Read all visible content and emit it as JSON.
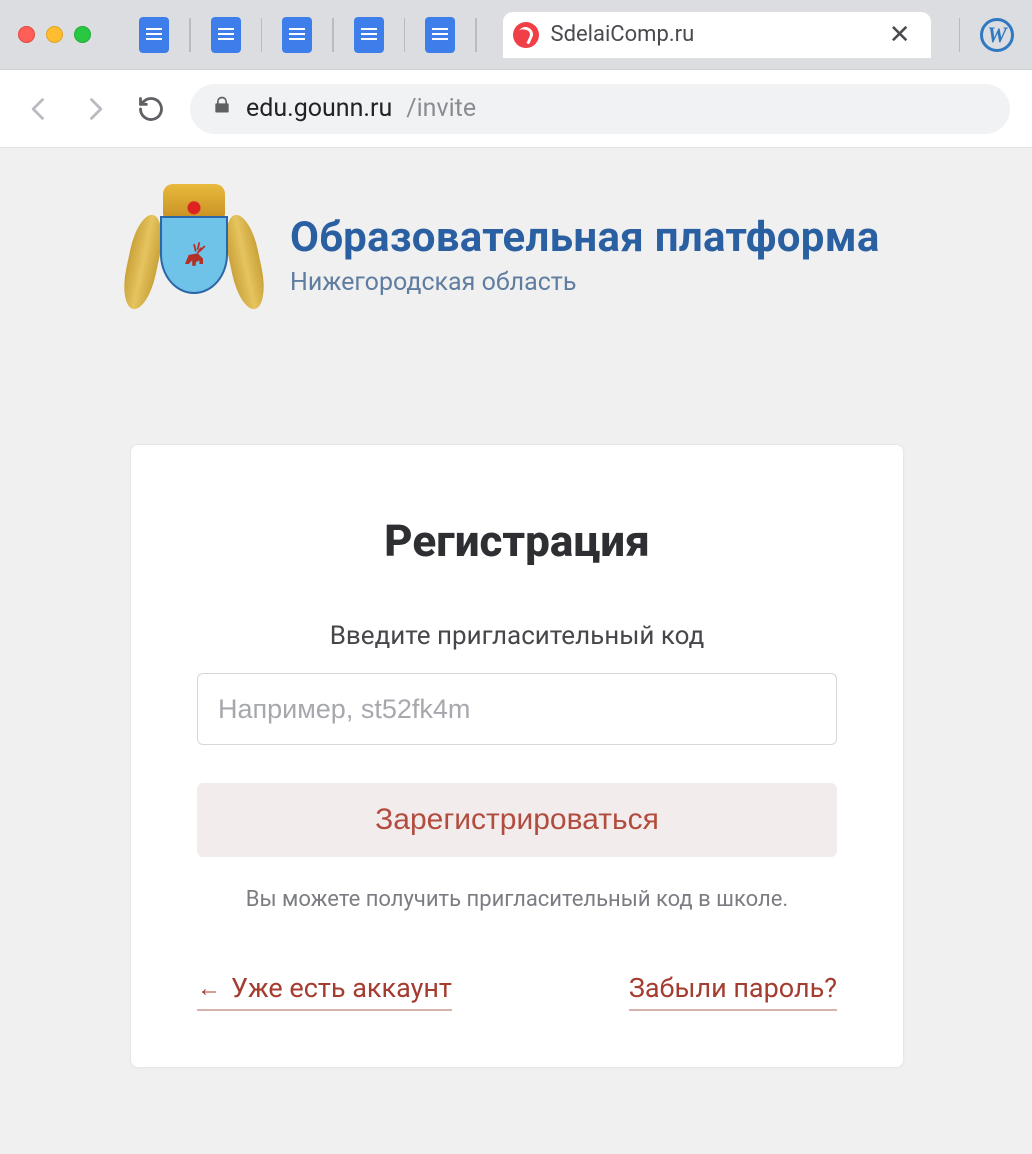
{
  "tabbar": {
    "site_tab_title": "SdelaiComp.ru"
  },
  "address": {
    "host": "edu.gounn.ru",
    "path": "/invite"
  },
  "brand": {
    "title": "Образовательная платформа",
    "subtitle": "Нижегородская область"
  },
  "card": {
    "title": "Регистрация",
    "label": "Введите пригласительный код",
    "placeholder": "Например, st52fk4m",
    "submit": "Зарегистрироваться",
    "help": "Вы можете получить пригласительный код в школе.",
    "back_link": "Уже есть аккаунт",
    "forgot_link": "Забыли пароль?"
  }
}
